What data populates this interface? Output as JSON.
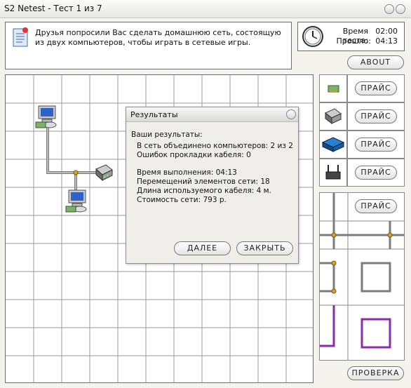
{
  "window": {
    "title": "S2 Netest - Тест 1 из 7"
  },
  "task": {
    "text": "Друзья попросили Вас сделать домашнюю сеть, состоящую из двух компьютеров, чтобы играть в сетевые игры."
  },
  "timer": {
    "time_label": "Время теста:",
    "time_value": "02:00",
    "elapsed_label": "Прошло:",
    "elapsed_value": "04:13"
  },
  "buttons": {
    "about": "ABOUT",
    "check": "ПРОВЕРКА"
  },
  "palette": {
    "price_label": "ПРАЙС",
    "items": [
      {
        "icon": "network-card-icon"
      },
      {
        "icon": "modem-icon"
      },
      {
        "icon": "switch-icon"
      },
      {
        "icon": "router-icon"
      }
    ]
  },
  "results_dialog": {
    "title": "Результаты",
    "heading": "Ваши результаты:",
    "lines1": [
      "В сеть объединено компьютеров: 2 из 2",
      "Ошибок прокладки кабеля: 0"
    ],
    "lines2": [
      "Время выполнения: 04:13",
      "Перемещений элементов сети: 18",
      "Длина используемого кабеля: 4 м.",
      "Стоимость сети: 793 р."
    ],
    "next_button": "ДАЛЕЕ",
    "close_button": "ЗАКРЫТЬ"
  },
  "colors": {
    "cable": "#8a8a8a",
    "junction": "#e0a020",
    "purple_cable": "#8c2bb0"
  }
}
